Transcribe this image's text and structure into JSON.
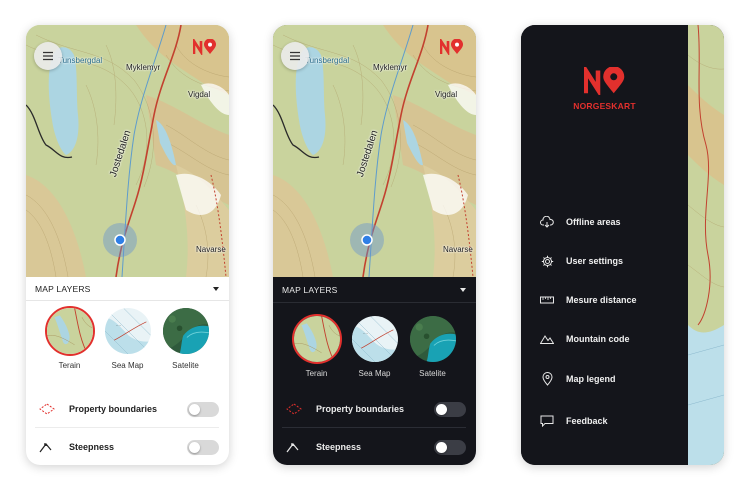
{
  "map": {
    "labels": {
      "lake": "Tunsbergdal",
      "myklemyr": "Myklemyr",
      "vigdal": "Vigdal",
      "jostedalen": "Jostedalen",
      "navarse": "Navarse"
    }
  },
  "layers_panel": {
    "header": "MAP LAYERS",
    "options": [
      {
        "label": "Terain",
        "selected": true
      },
      {
        "label": "Sea Map",
        "selected": false
      },
      {
        "label": "Satelite",
        "selected": false
      }
    ],
    "toggles": [
      {
        "label": "Property boundaries",
        "on": false,
        "icon": "dashed-diamond-icon"
      },
      {
        "label": "Steepness",
        "on": false,
        "icon": "steepness-icon"
      }
    ]
  },
  "drawer": {
    "brand": "NORGESKART",
    "items": [
      {
        "label": "Offline areas",
        "icon": "cloud-download-icon"
      },
      {
        "label": "User settings",
        "icon": "gear-icon"
      },
      {
        "label": "Mesure distance",
        "icon": "ruler-icon"
      },
      {
        "label": "Mountain code",
        "icon": "mountain-icon"
      },
      {
        "label": "Map legend",
        "icon": "map-pin-icon"
      },
      {
        "label": "Feedback",
        "icon": "chat-icon"
      }
    ]
  },
  "colors": {
    "accent": "#e2302d",
    "dark_bg": "#14151b",
    "map_green": "#b9c98a",
    "water": "#a9d3e0",
    "location_dot": "#2f7fe6"
  }
}
